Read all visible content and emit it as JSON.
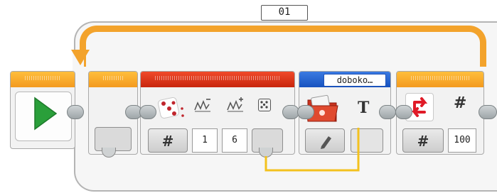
{
  "loop": {
    "label": "01"
  },
  "random_block": {
    "lower_value": "1",
    "upper_value": "6",
    "output_symbol": "#"
  },
  "display_block": {
    "file_label": "doboko…",
    "mode_glyph": "T"
  },
  "loop_block": {
    "symbol": "#",
    "count_value": "100"
  },
  "colors": {
    "loop": "#f3a32c",
    "start": "#f39a1f",
    "random": "#c8260d",
    "display": "#1752bf",
    "wire": "#f3c11e"
  }
}
